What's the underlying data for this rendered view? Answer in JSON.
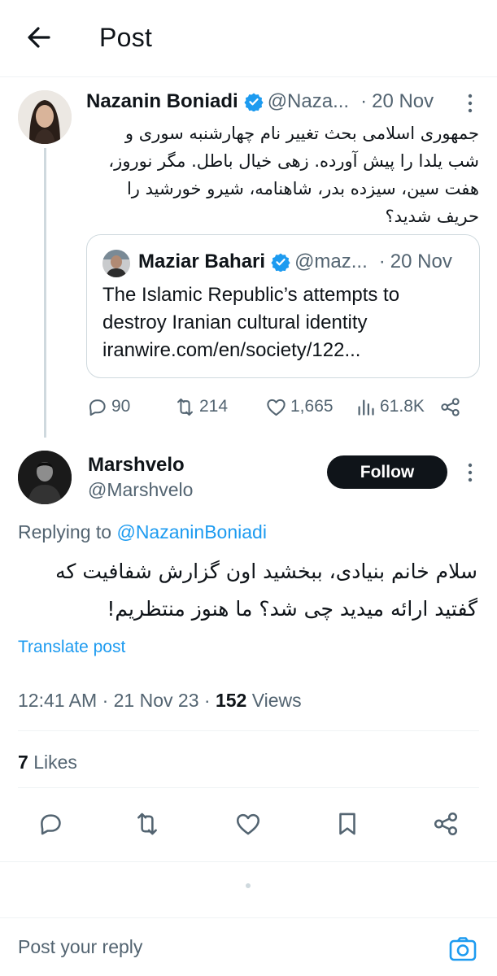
{
  "header": {
    "title": "Post",
    "back_icon": "back-arrow-icon"
  },
  "original_tweet": {
    "name": "Nazanin Boniadi",
    "handle": "@Naza...",
    "separator": "·",
    "date": "20 Nov",
    "verified": true,
    "text_lines": [
      "جمهوری اسلامی بحث تغییر نام  چهارشنبه سوری و",
      "شب یلدا را پیش آورده. زهی خیال باطل. مگر نوروز،",
      "هفت سین، سیزده بدر، شاهنامه، شیرو خورشید را",
      "حریف شدید؟"
    ],
    "quote": {
      "name": "Maziar Bahari",
      "handle": "@maz...",
      "separator": "·",
      "date": "20 Nov",
      "verified": true,
      "text_lines": [
        "The Islamic Republic’s attempts to",
        "destroy Iranian cultural identity",
        "iranwire.com/en/society/122..."
      ]
    },
    "stats": {
      "replies": "90",
      "reposts": "214",
      "likes": "1,665",
      "views": "61.8K"
    }
  },
  "reply_tweet": {
    "name": "Marshvelo",
    "handle": "@Marshvelo",
    "follow_label": "Follow",
    "replying_prefix": "Replying to ",
    "replying_to": "@NazaninBoniadi",
    "text_lines": [
      "سلام خانم بنیادی، ببخشید اون گزارش شفافیت که",
      "گفتید ارائه میدید چی شد؟ ما هنوز منتظریم!"
    ],
    "translate_label": "Translate post",
    "time": "12:41 AM",
    "separator": "·",
    "date": "21 Nov 23",
    "views_count": "152",
    "views_label": "Views",
    "likes_count": "7",
    "likes_label": "Likes"
  },
  "reply_box": {
    "placeholder": "Post your reply"
  },
  "colors": {
    "accent": "#1d9bf0",
    "text": "#0f1419",
    "muted": "#536471",
    "border": "#cfd9de",
    "follow_bg": "#0f1419"
  }
}
